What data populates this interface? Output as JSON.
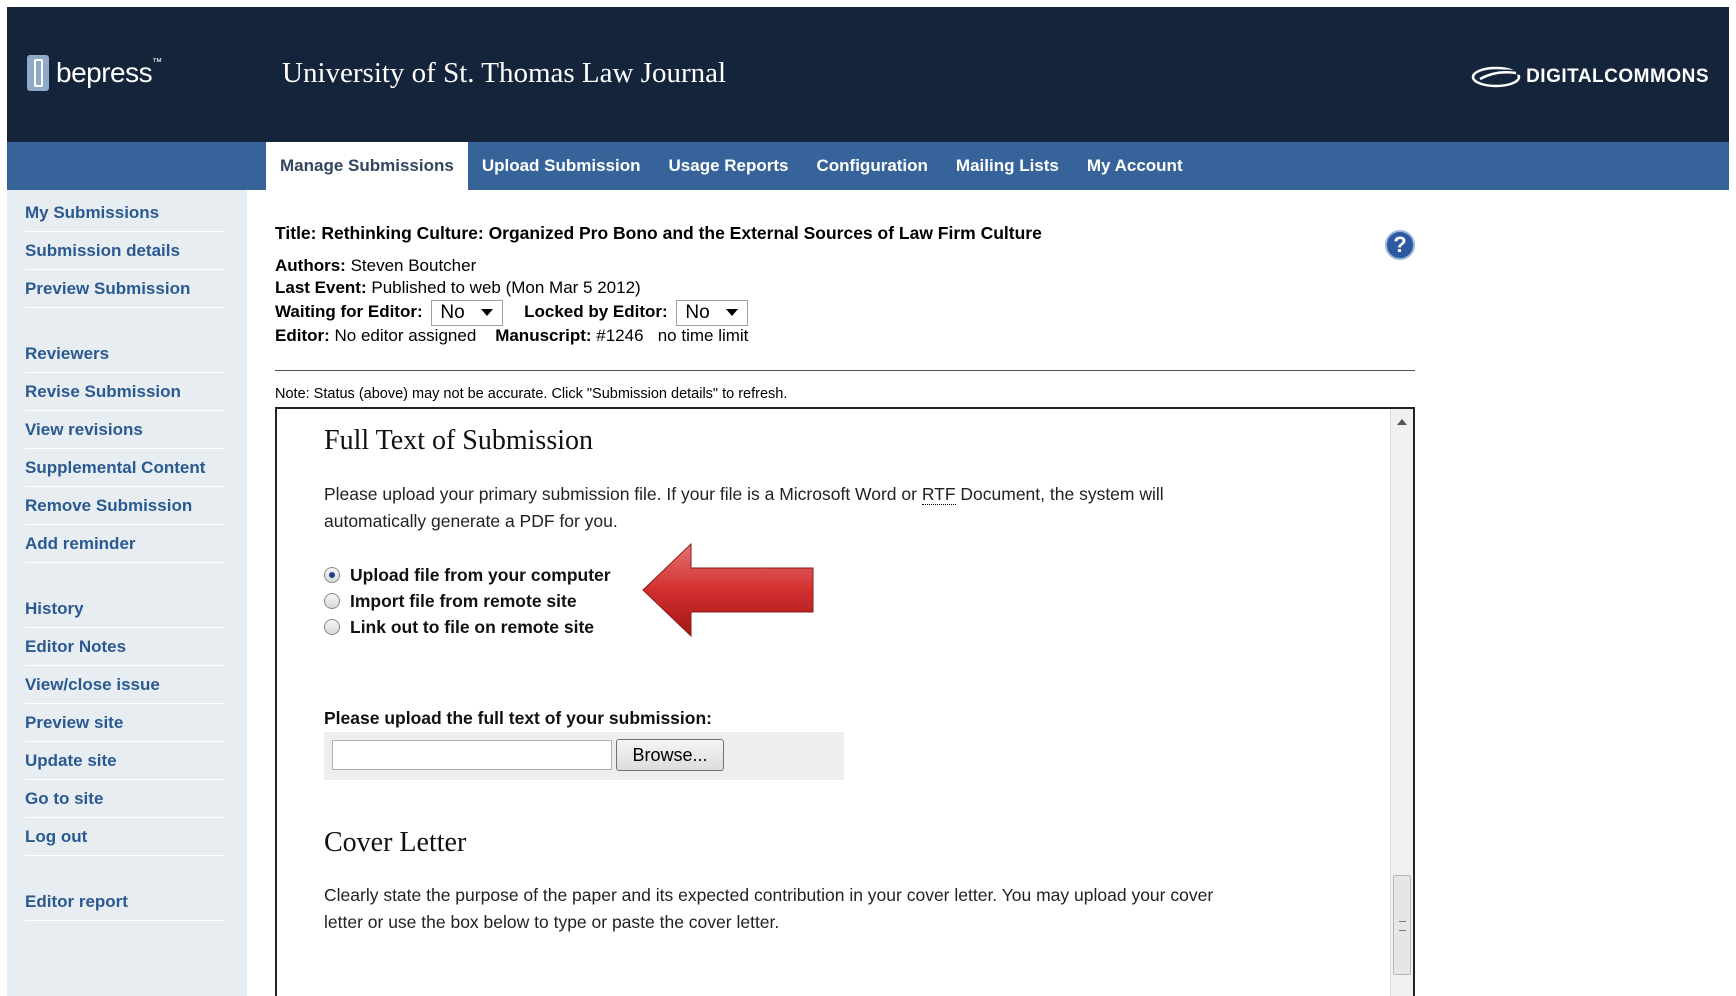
{
  "header": {
    "logo_text": "bepress",
    "logo_tm": "™",
    "journal_title": "University of St. Thomas Law Journal",
    "brand_text": "DIGITALCOMMONS"
  },
  "tabs": [
    {
      "label": "Manage Submissions",
      "active": true
    },
    {
      "label": "Upload Submission"
    },
    {
      "label": "Usage Reports"
    },
    {
      "label": "Configuration"
    },
    {
      "label": "Mailing Lists"
    },
    {
      "label": "My Account"
    }
  ],
  "sidebar": {
    "items": [
      "My Submissions",
      "Submission details",
      "Preview Submission",
      "Reviewers",
      "Revise Submission",
      "View revisions",
      "Supplemental Content",
      "Remove Submission",
      "Add reminder",
      "History",
      "Editor Notes",
      "View/close issue",
      "Preview site",
      "Update site",
      "Go to site",
      "Log out",
      "Editor report"
    ]
  },
  "submission": {
    "title": "Title: Rethinking Culture: Organized Pro Bono and the External Sources of Law Firm Culture",
    "authors_label": "Authors:",
    "authors": "Steven Boutcher",
    "last_event_label": "Last Event:",
    "last_event": "Published to web (Mon Mar 5 2012)",
    "waiting_label": "Waiting for Editor:",
    "waiting_value": "No",
    "locked_label": "Locked by Editor:",
    "locked_value": "No",
    "editor_label": "Editor:",
    "editor": "No editor assigned",
    "manuscript_label": "Manuscript:",
    "manuscript": "#1246",
    "time_limit": "no time limit",
    "note": "Note: Status (above) may not be accurate. Click \"Submission details\" to refresh.",
    "help_icon": "?"
  },
  "panel": {
    "full_text_heading": "Full Text of Submission",
    "full_text_para_1": "Please upload your primary submission file. If your file is a Microsoft Word or ",
    "full_text_abbr": "RTF",
    "full_text_para_2": " Document, the system will automatically generate a PDF for you.",
    "options": [
      {
        "label": "Upload file from your computer",
        "selected": true
      },
      {
        "label": "Import file from remote site",
        "selected": false
      },
      {
        "label": "Link out to file on remote site",
        "selected": false
      }
    ],
    "upload_label": "Please upload the full text of your submission:",
    "browse_label": "Browse...",
    "cover_heading": "Cover Letter",
    "cover_para": "Clearly state the purpose of the paper and its expected contribution in your cover letter. You may upload your cover letter or use the box below to type or paste the cover letter."
  },
  "colors": {
    "header_bg": "#14243a",
    "nav_bg": "#35639a",
    "sidebar_bg": "#e8edf2",
    "link": "#2a5a91",
    "arrow": "#c62828"
  }
}
